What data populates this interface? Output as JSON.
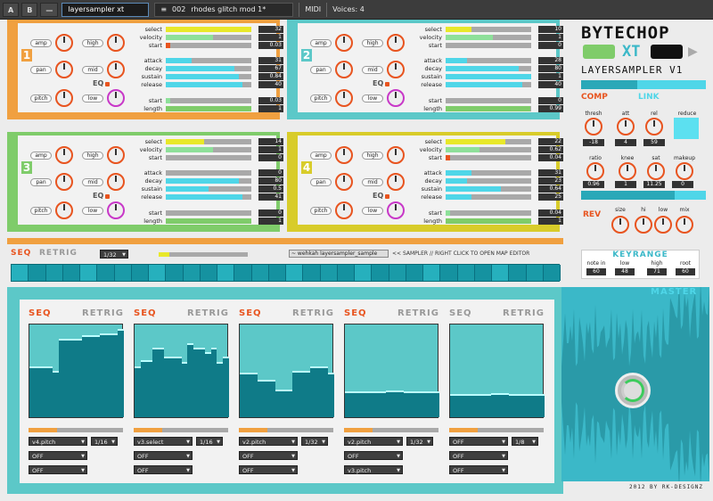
{
  "topbar": {
    "a": "A",
    "b": "B",
    "minus": "—",
    "instrument": "layersampler xt",
    "preset_num": "002",
    "preset_name": "rhodes glitch mod 1*",
    "midi": "MIDI",
    "voices": "Voices: 4"
  },
  "layers": [
    {
      "num": "1",
      "color": "#f0a040",
      "select": "32",
      "velocity": "1",
      "start": "0.03",
      "attack": "31",
      "decay": "67",
      "sustain": "0.84",
      "release": "40",
      "start2": "0.03",
      "length": "1",
      "f": [
        1,
        0.55,
        0.05,
        0.3,
        0.8,
        0.85,
        0.9,
        0.05,
        1
      ]
    },
    {
      "num": "2",
      "color": "#5cc8c8",
      "select": "10",
      "velocity": "1",
      "start": "0",
      "attack": "28",
      "decay": "80",
      "sustain": "1",
      "release": "40",
      "start2": "0",
      "length": "0.99",
      "f": [
        0.3,
        0.55,
        0,
        0.25,
        0.85,
        1,
        0.9,
        0,
        0.99
      ]
    },
    {
      "num": "3",
      "color": "#7fcc6a",
      "select": "14",
      "velocity": "1",
      "start": "0",
      "attack": "0",
      "decay": "80",
      "sustain": "0.5",
      "release": "41",
      "start2": "0",
      "length": "1",
      "f": [
        0.45,
        0.55,
        0,
        0,
        0.85,
        0.5,
        0.9,
        0,
        1
      ]
    },
    {
      "num": "4",
      "color": "#d8cc2a",
      "select": "22",
      "velocity": "0.62",
      "start": "0.04",
      "attack": "31",
      "decay": "23",
      "sustain": "0.64",
      "release": "25",
      "start2": "0.04",
      "length": "1",
      "f": [
        0.7,
        0.4,
        0.05,
        0.3,
        0.25,
        0.65,
        0.3,
        0.05,
        1
      ]
    }
  ],
  "labels": {
    "select": "select",
    "velocity": "velocity",
    "start": "start",
    "attack": "attack",
    "decay": "decay",
    "sustain": "sustain",
    "release": "release",
    "length": "length",
    "amp": "amp",
    "pan": "pan",
    "pitch": "pitch",
    "high": "high",
    "mid": "mid",
    "low": "low",
    "eq": "EQ"
  },
  "brand": {
    "title": "BYTECHOP",
    "sub": "LAYERSAMPLER V1",
    "xt": "XT"
  },
  "comp": {
    "comp": "COMP",
    "link": "LINK",
    "thresh": "thresh",
    "att": "att",
    "rel": "rel",
    "reduce": "reduce",
    "thresh_v": "-18",
    "att_v": "4",
    "rel_v": "59",
    "ratio": "ratio",
    "knee": "knee",
    "sat": "sat",
    "makeup": "makeup",
    "ratio_v": "0.96",
    "knee_v": "1",
    "sat_v": "11.25",
    "makeup_v": "0"
  },
  "rev": {
    "rev": "REV",
    "size": "size",
    "hi": "hi",
    "low": "low",
    "mix": "mix"
  },
  "keyrange": {
    "title": "KEYRANGE",
    "note_in": "note in",
    "low": "low",
    "high": "high",
    "root": "root",
    "note_in_v": "60",
    "low_v": "48",
    "high_v": "71",
    "root_v": "60"
  },
  "seq": {
    "seq": "SEQ",
    "retrig": "RETRIG",
    "div": "1/32",
    "file": "~ wehkah layersampler_sample",
    "hint": "<< SAMPLER // RIGHT CLICK TO OPEN MAP EDITOR"
  },
  "master": "MASTER",
  "footer": "2012 BY RK-DESIGNZ",
  "mods": [
    {
      "target": "v4.pitch",
      "div": "1/16",
      "m2": "OFF",
      "m3": "OFF",
      "bars": [
        0.55,
        0.55,
        0.55,
        0.55,
        0.5,
        0.85,
        0.85,
        0.85,
        0.85,
        0.88,
        0.88,
        0.88,
        0.9,
        0.9,
        0.9,
        0.95
      ]
    },
    {
      "target": "v3.select",
      "div": "1/16",
      "m2": "OFF",
      "m3": "OFF",
      "bars": [
        0.55,
        0.62,
        0.62,
        0.75,
        0.75,
        0.65,
        0.65,
        0.65,
        0.6,
        0.8,
        0.75,
        0.75,
        0.7,
        0.75,
        0.6,
        0.65
      ]
    },
    {
      "target": "v2.pitch",
      "div": "1/32",
      "m2": "OFF",
      "m3": "OFF",
      "bars": [
        0.48,
        0.48,
        0.48,
        0.4,
        0.4,
        0.4,
        0.3,
        0.3,
        0.3,
        0.5,
        0.5,
        0.5,
        0.55,
        0.55,
        0.55,
        0.48
      ]
    },
    {
      "target": "v2.pitch",
      "div": "1/32",
      "m2": "OFF",
      "m3": "v3.pitch",
      "bars": [
        0.28,
        0.28,
        0.28,
        0.28,
        0.28,
        0.28,
        0.28,
        0.29,
        0.29,
        0.29,
        0.28,
        0.28,
        0.28,
        0.28,
        0.28,
        0.28
      ]
    },
    {
      "target": "OFF",
      "div": "1/8",
      "m2": "OFF",
      "m3": "OFF",
      "bars": [
        0.25,
        0.25,
        0.25,
        0.25,
        0.25,
        0.25,
        0.25,
        0.26,
        0.26,
        0.26,
        0.25,
        0.25,
        0.25,
        0.25,
        0.25,
        0.25
      ]
    }
  ]
}
